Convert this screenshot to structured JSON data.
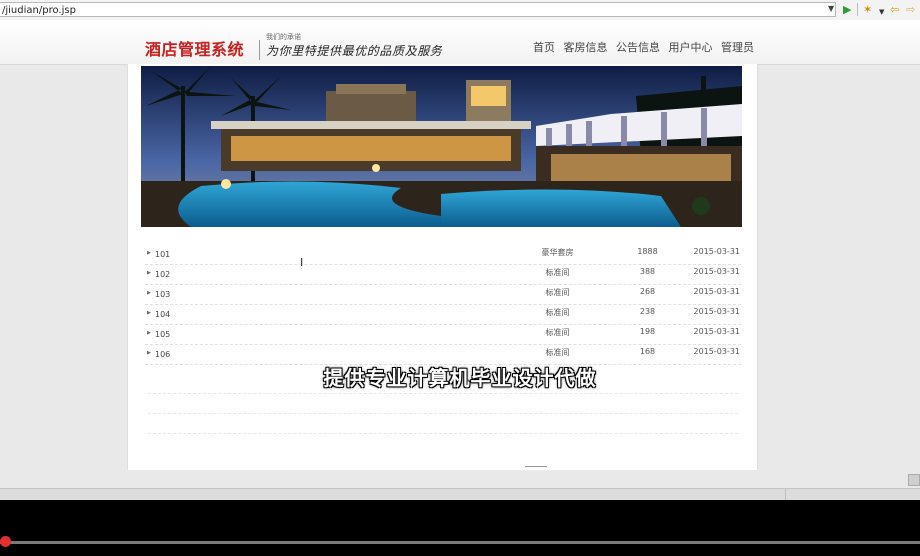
{
  "browser": {
    "url": "/jiudian/pro.jsp"
  },
  "site": {
    "logo": "酒店管理系统",
    "slogan_small": "我们的承诺",
    "slogan": "为你里特提供最优的品质及服务",
    "nav": [
      "首页",
      "客房信息",
      "公告信息",
      "用户中心",
      "管理员"
    ]
  },
  "rooms": [
    {
      "number": "101",
      "type": "豪华套房",
      "price": "1888",
      "date": "2015-03-31"
    },
    {
      "number": "102",
      "type": "标准间",
      "price": "388",
      "date": "2015-03-31"
    },
    {
      "number": "103",
      "type": "标准间",
      "price": "268",
      "date": "2015-03-31"
    },
    {
      "number": "104",
      "type": "标准间",
      "price": "238",
      "date": "2015-03-31"
    },
    {
      "number": "105",
      "type": "标准间",
      "price": "198",
      "date": "2015-03-31"
    },
    {
      "number": "106",
      "type": "标准间",
      "price": "168",
      "date": "2015-03-31"
    }
  ],
  "overlay": "提供专业计算机毕业设计代做",
  "icons": [
    "go-icon",
    "bookmark-icon",
    "back-icon",
    "forward-icon"
  ],
  "colors": {
    "logo": "#c9201f",
    "progress_knob": "#e0312e"
  }
}
